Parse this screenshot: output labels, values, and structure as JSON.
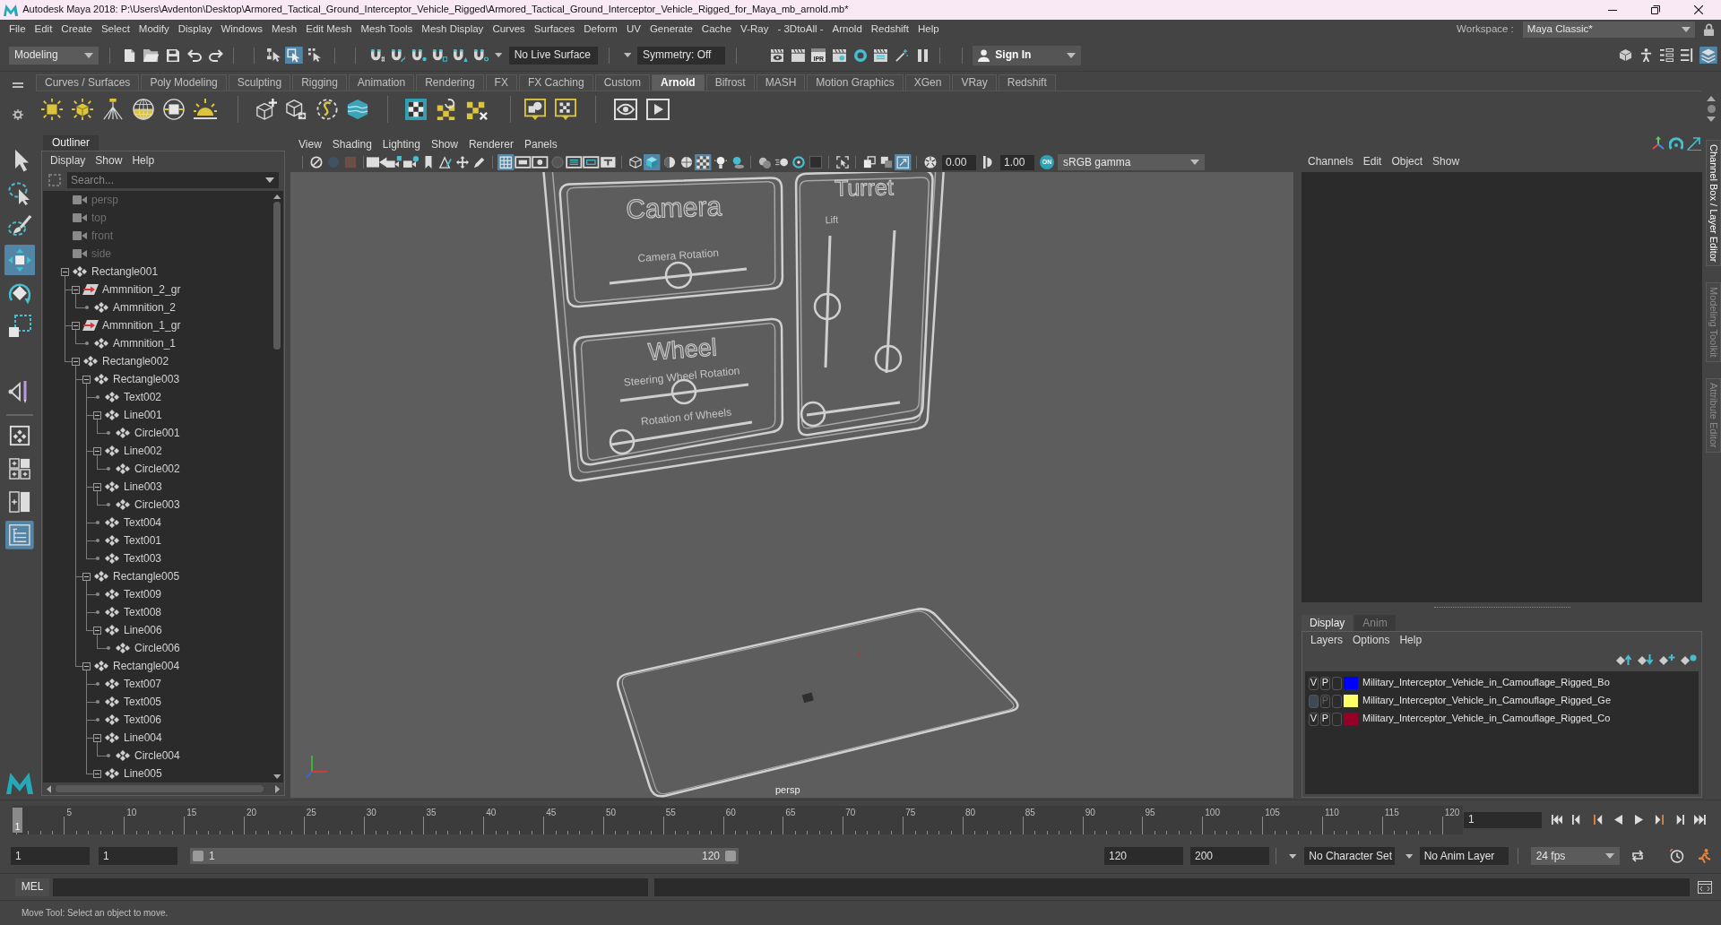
{
  "window": {
    "title": "Autodesk Maya 2018: P:\\Users\\Avdenton\\Desktop\\Armored_Tactical_Ground_Interceptor_Vehicle_Rigged\\Armored_Tactical_Ground_Interceptor_Vehicle_Rigged_for_Maya_mb_arnold.mb*"
  },
  "menu_bar": {
    "items": [
      "File",
      "Edit",
      "Create",
      "Select",
      "Modify",
      "Display",
      "Windows",
      "Mesh",
      "Edit Mesh",
      "Mesh Tools",
      "Mesh Display",
      "Curves",
      "Surfaces",
      "Deform",
      "UV",
      "Generate",
      "Cache",
      "V-Ray",
      "- 3DtoAll -",
      "Arnold",
      "Redshift",
      "Help"
    ],
    "workspace_label": "Workspace :",
    "workspace": "Maya Classic*"
  },
  "status_line": {
    "menu_set": "Modeling",
    "selection_modes": [
      {
        "selected": false
      },
      {
        "selected": true
      },
      {
        "selected": false
      }
    ],
    "live_surface": "No Live Surface",
    "symmetry": "Symmetry: Off",
    "ipr_label": "IPR",
    "sign_in": "Sign In",
    "panel_toggles": [
      {
        "selected": false
      },
      {
        "selected": false
      },
      {
        "selected": false
      },
      {
        "selected": false
      },
      {
        "selected": true
      }
    ]
  },
  "shelf": {
    "tabs": [
      {
        "label": "Curves / Surfaces",
        "selected": false
      },
      {
        "label": "Poly Modeling",
        "selected": false
      },
      {
        "label": "Sculpting",
        "selected": false
      },
      {
        "label": "Rigging",
        "selected": false
      },
      {
        "label": "Animation",
        "selected": false
      },
      {
        "label": "Rendering",
        "selected": false
      },
      {
        "label": "FX",
        "selected": false
      },
      {
        "label": "FX Caching",
        "selected": false
      },
      {
        "label": "Custom",
        "selected": false
      },
      {
        "label": "Arnold",
        "selected": true
      },
      {
        "label": "Bifrost",
        "selected": false
      },
      {
        "label": "MASH",
        "selected": false
      },
      {
        "label": "Motion Graphics",
        "selected": false
      },
      {
        "label": "XGen",
        "selected": false
      },
      {
        "label": "VRay",
        "selected": false
      },
      {
        "label": "Redshift",
        "selected": false
      }
    ]
  },
  "toolbox": {
    "tools": [
      {
        "selected": false
      },
      {
        "selected": false
      },
      {
        "selected": false
      },
      {
        "selected": true
      },
      {
        "selected": false
      },
      {
        "selected": false
      },
      {
        "selected": false
      }
    ],
    "layouts": [
      {
        "selected": false
      },
      {
        "selected": false
      },
      {
        "selected": false
      },
      {
        "selected": true
      }
    ]
  },
  "outliner": {
    "title": "Outliner",
    "menu": [
      "Display",
      "Show",
      "Help"
    ],
    "search": {
      "placeholder": "Search..."
    },
    "tree": [
      {
        "label": "persp",
        "kind": "camera",
        "hidden": true
      },
      {
        "label": "top",
        "kind": "camera",
        "hidden": true
      },
      {
        "label": "front",
        "kind": "camera",
        "hidden": true
      },
      {
        "label": "side",
        "kind": "camera",
        "hidden": true
      },
      {
        "label": "Rectangle001",
        "kind": "transform",
        "hidden": false,
        "expanded": true,
        "children": [
          {
            "label": "Ammnition_2_gr",
            "kind": "rig",
            "hidden": false,
            "expanded": true,
            "children": [
              {
                "label": "Ammnition_2",
                "kind": "transform",
                "hidden": false
              }
            ]
          },
          {
            "label": "Ammnition_1_gr",
            "kind": "rig",
            "hidden": false,
            "expanded": true,
            "children": [
              {
                "label": "Ammnition_1",
                "kind": "transform",
                "hidden": false
              }
            ]
          },
          {
            "label": "Rectangle002",
            "kind": "transform",
            "hidden": false,
            "expanded": true,
            "children": [
              {
                "label": "Rectangle003",
                "kind": "transform",
                "hidden": false,
                "expanded": true,
                "children": [
                  {
                    "label": "Text002",
                    "kind": "transform",
                    "hidden": false
                  },
                  {
                    "label": "Line001",
                    "kind": "transform",
                    "hidden": false,
                    "expanded": true,
                    "children": [
                      {
                        "label": "Circle001",
                        "kind": "transform",
                        "hidden": false
                      }
                    ]
                  },
                  {
                    "label": "Line002",
                    "kind": "transform",
                    "hidden": false,
                    "expanded": true,
                    "children": [
                      {
                        "label": "Circle002",
                        "kind": "transform",
                        "hidden": false
                      }
                    ]
                  },
                  {
                    "label": "Line003",
                    "kind": "transform",
                    "hidden": false,
                    "expanded": true,
                    "children": [
                      {
                        "label": "Circle003",
                        "kind": "transform",
                        "hidden": false
                      }
                    ]
                  },
                  {
                    "label": "Text004",
                    "kind": "transform",
                    "hidden": false
                  },
                  {
                    "label": "Text001",
                    "kind": "transform",
                    "hidden": false
                  },
                  {
                    "label": "Text003",
                    "kind": "transform",
                    "hidden": false
                  }
                ]
              },
              {
                "label": "Rectangle005",
                "kind": "transform",
                "hidden": false,
                "expanded": true,
                "children": [
                  {
                    "label": "Text009",
                    "kind": "transform",
                    "hidden": false
                  },
                  {
                    "label": "Text008",
                    "kind": "transform",
                    "hidden": false
                  },
                  {
                    "label": "Line006",
                    "kind": "transform",
                    "hidden": false,
                    "expanded": true,
                    "children": [
                      {
                        "label": "Circle006",
                        "kind": "transform",
                        "hidden": false
                      }
                    ]
                  }
                ]
              },
              {
                "label": "Rectangle004",
                "kind": "transform",
                "hidden": false,
                "expanded": true,
                "children": [
                  {
                    "label": "Text007",
                    "kind": "transform",
                    "hidden": false
                  },
                  {
                    "label": "Text005",
                    "kind": "transform",
                    "hidden": false
                  },
                  {
                    "label": "Text006",
                    "kind": "transform",
                    "hidden": false
                  },
                  {
                    "label": "Line004",
                    "kind": "transform",
                    "hidden": false,
                    "expanded": true,
                    "children": [
                      {
                        "label": "Circle004",
                        "kind": "transform",
                        "hidden": false
                      }
                    ]
                  },
                  {
                    "label": "Line005",
                    "kind": "transform",
                    "hidden": false,
                    "expanded": true
                  }
                ]
              }
            ]
          }
        ]
      }
    ]
  },
  "viewport": {
    "menu": [
      "View",
      "Shading",
      "Lighting",
      "Show",
      "Renderer",
      "Panels"
    ],
    "toolbar_groups": [
      [
        {
          "selected": false
        },
        {
          "selected": false
        },
        {
          "selected": false
        }
      ],
      [
        {
          "selected": false
        },
        {
          "selected": false
        },
        {
          "selected": false
        },
        {
          "selected": false
        },
        {
          "selected": false
        },
        {
          "selected": false
        },
        {
          "selected": false
        }
      ],
      [
        {
          "selected": true
        },
        {
          "selected": false
        },
        {
          "selected": false
        },
        {
          "selected": false
        },
        {
          "selected": false
        },
        {
          "selected": false
        },
        {
          "selected": false
        }
      ],
      [
        {
          "selected": false
        },
        {
          "selected": true
        },
        {
          "selected": false
        },
        {
          "selected": false
        },
        {
          "selected": true
        },
        {
          "selected": false
        },
        {
          "selected": false
        }
      ],
      [
        {
          "selected": false
        },
        {
          "selected": false
        },
        {
          "selected": false
        },
        {
          "selected": false
        }
      ],
      [
        {
          "selected": false
        }
      ],
      [
        {
          "selected": false
        },
        {
          "selected": false
        },
        {
          "selected": true
        }
      ]
    ],
    "exposure": "0.00",
    "gamma": "1.00",
    "color_management": {
      "on": true,
      "badge": "ON"
    },
    "view_transform": "sRGB gamma",
    "scene_labels": [
      "Camera",
      "Camera Rotation",
      "Wheel",
      "Steering Wheel Rotation",
      "Rotation of Wheels",
      "Turret",
      "Lift"
    ],
    "camera": "persp"
  },
  "channel_box": {
    "menu": [
      "Channels",
      "Edit",
      "Object",
      "Show"
    ]
  },
  "layer_editor": {
    "tabs": [
      {
        "label": "Display",
        "selected": true
      },
      {
        "label": "Anim",
        "selected": false
      }
    ],
    "menu": [
      "Layers",
      "Options",
      "Help"
    ],
    "layers": [
      {
        "visible": true,
        "visibility_label": "V",
        "playback": true,
        "playback_label": "P",
        "color": "#0000ff",
        "name": "Military_Interceptor_Vehicle_in_Camouflage_Rigged_Bo"
      },
      {
        "visible": false,
        "playback": false,
        "playback_label": "P",
        "color": "#ffff66",
        "name": "Military_Interceptor_Vehicle_in_Camouflage_Rigged_Ge"
      },
      {
        "visible": true,
        "visibility_label": "V",
        "playback": true,
        "playback_label": "P",
        "color": "#960028",
        "name": "Military_Interceptor_Vehicle_in_Camouflage_Rigged_Co"
      }
    ]
  },
  "side_tabs": [
    {
      "label": "Channel Box / Layer Editor",
      "selected": true
    },
    {
      "label": "Modeling Toolkit",
      "selected": false
    },
    {
      "label": "Attribute Editor",
      "selected": false
    }
  ],
  "time_slider": {
    "current_frame": "1",
    "level": 0,
    "ticks": [
      "5",
      "10",
      "15",
      "20",
      "25",
      "30",
      "35",
      "40",
      "45",
      "50",
      "55",
      "60",
      "65",
      "70",
      "75",
      "80",
      "85",
      "90",
      "95",
      "100",
      "105",
      "110",
      "115",
      "120"
    ],
    "current_frame_field": "1"
  },
  "range_slider": {
    "start": "1",
    "playback_start": "1",
    "level": 1,
    "range_start": "1",
    "range_end": "120",
    "playback_end": "120",
    "end": "200",
    "character_set": "No Character Set",
    "anim_layer": "No Anim Layer",
    "fps": "24 fps"
  },
  "command_line": {
    "language": "MEL"
  },
  "help_line": {
    "text": "Move Tool: Select an object to move."
  }
}
